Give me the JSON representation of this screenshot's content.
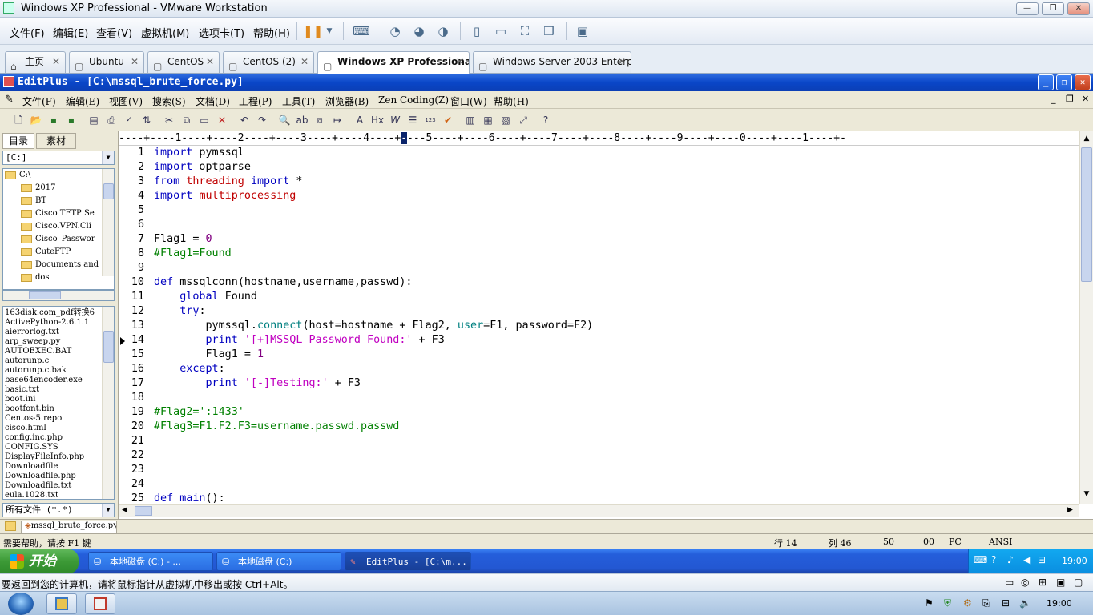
{
  "vmware": {
    "title": "Windows XP Professional - VMware Workstation",
    "menu": [
      "文件(F)",
      "编辑(E)",
      "查看(V)",
      "虚拟机(M)",
      "选项卡(T)",
      "帮助(H)"
    ],
    "tabs": [
      "主页",
      "Ubuntu",
      "CentOS",
      "CentOS (2)",
      "Windows XP Professional",
      "Windows Server 2003 Enterpr..."
    ],
    "hint": "要返回到您的计算机，请将鼠标指针从虚拟机中移出或按 Ctrl+Alt。"
  },
  "editplus": {
    "title": "EditPlus - [C:\\mssql_brute_force.py]",
    "menu": [
      "文件(F)",
      "编辑(E)",
      "视图(V)",
      "搜索(S)",
      "文档(D)",
      "工程(P)",
      "工具(T)",
      "浏览器(B)",
      "Zen Coding(Z)",
      "窗口(W)",
      "帮助(H)"
    ],
    "left_tabs": [
      "目录",
      "素材"
    ],
    "drive": "[C:]",
    "tree": [
      "C:\\",
      "2017",
      "BT",
      "Cisco TFTP Se",
      "Cisco.VPN.Cli",
      "Cisco_Passwor",
      "CuteFTP",
      "Documents and",
      "dos"
    ],
    "files": [
      "163disk.com_pdf转换6",
      "ActivePython-2.6.1.1",
      "aierrorlog.txt",
      "arp_sweep.py",
      "AUTOEXEC.BAT",
      "autorunp.c",
      "autorunp.c.bak",
      "base64encoder.exe",
      "basic.txt",
      "boot.ini",
      "bootfont.bin",
      "Centos-5.repo",
      "cisco.html",
      "config.inc.php",
      "CONFIG.SYS",
      "DisplayFileInfo.php",
      "Downloadfile",
      "Downloadfile.php",
      "Downloadfile.txt",
      "eula.1028.txt"
    ],
    "file_filter": "所有文件 (*.*)",
    "ruler_before": "----+----1----+----2----+----3----+----4----+",
    "ruler_cursor": "-",
    "ruler_after": "---5----+----6----+----7----+----8----+----9----+----0----+----1----+-",
    "doc_tab": "mssql_brute_force.py",
    "status": {
      "help": "需要帮助，请按 F1 键",
      "line": "行 14",
      "col": "列 46",
      "v1": "50",
      "v2": "00",
      "fmt": "PC",
      "enc": "ANSI"
    }
  },
  "code": [
    [
      [
        "kw",
        "import"
      ],
      [
        "op",
        " pymssql"
      ]
    ],
    [
      [
        "kw",
        "import"
      ],
      [
        "op",
        " optparse"
      ]
    ],
    [
      [
        "kw",
        "from"
      ],
      [
        "op",
        " "
      ],
      [
        "md",
        "threading"
      ],
      [
        "op",
        " "
      ],
      [
        "kw",
        "import"
      ],
      [
        "op",
        " *"
      ]
    ],
    [
      [
        "kw",
        "import"
      ],
      [
        "op",
        " "
      ],
      [
        "md",
        "multiprocessing"
      ]
    ],
    [],
    [],
    [
      [
        "op",
        "Flag1 = "
      ],
      [
        "num",
        "0"
      ]
    ],
    [
      [
        "cm",
        "#Flag1=Found"
      ]
    ],
    [],
    [
      [
        "kw",
        "def"
      ],
      [
        "op",
        " mssqlconn(hostname,username,passwd):"
      ]
    ],
    [
      [
        "op",
        "    "
      ],
      [
        "kw",
        "global"
      ],
      [
        "op",
        " Found"
      ]
    ],
    [
      [
        "op",
        "    "
      ],
      [
        "kw",
        "try"
      ],
      [
        "op",
        ":"
      ]
    ],
    [
      [
        "op",
        "        pymssql."
      ],
      [
        "fn",
        "connect"
      ],
      [
        "op",
        "(host=hostname + Flag2, "
      ],
      [
        "fn",
        "user"
      ],
      [
        "op",
        "=F1, password=F2)"
      ]
    ],
    [
      [
        "op",
        "        "
      ],
      [
        "kw",
        "print"
      ],
      [
        "op",
        " "
      ],
      [
        "str",
        "'[+]MSSQL Password Found:'"
      ],
      [
        "op",
        " + F3"
      ]
    ],
    [
      [
        "op",
        "        Flag1 = "
      ],
      [
        "num",
        "1"
      ]
    ],
    [
      [
        "op",
        "    "
      ],
      [
        "kw",
        "except"
      ],
      [
        "op",
        ":"
      ]
    ],
    [
      [
        "op",
        "        "
      ],
      [
        "kw",
        "print"
      ],
      [
        "op",
        " "
      ],
      [
        "str",
        "'[-]Testing:'"
      ],
      [
        "op",
        " + F3"
      ]
    ],
    [],
    [
      [
        "cm",
        "#Flag2=':1433'"
      ]
    ],
    [
      [
        "cm",
        "#Flag3=F1.F2.F3=username.passwd.passwd"
      ]
    ],
    [],
    [],
    [],
    [],
    [
      [
        "kw",
        "def"
      ],
      [
        "op",
        " "
      ],
      [
        "kw",
        "main"
      ],
      [
        "op",
        "():"
      ]
    ]
  ],
  "xp_taskbar": {
    "start": "开始",
    "buttons": [
      "本地磁盘 (C:) - ...",
      "本地磁盘 (C:)",
      "EditPlus - [C:\\m..."
    ],
    "clock": "19:00"
  },
  "win7": {
    "clock": "19:00"
  }
}
